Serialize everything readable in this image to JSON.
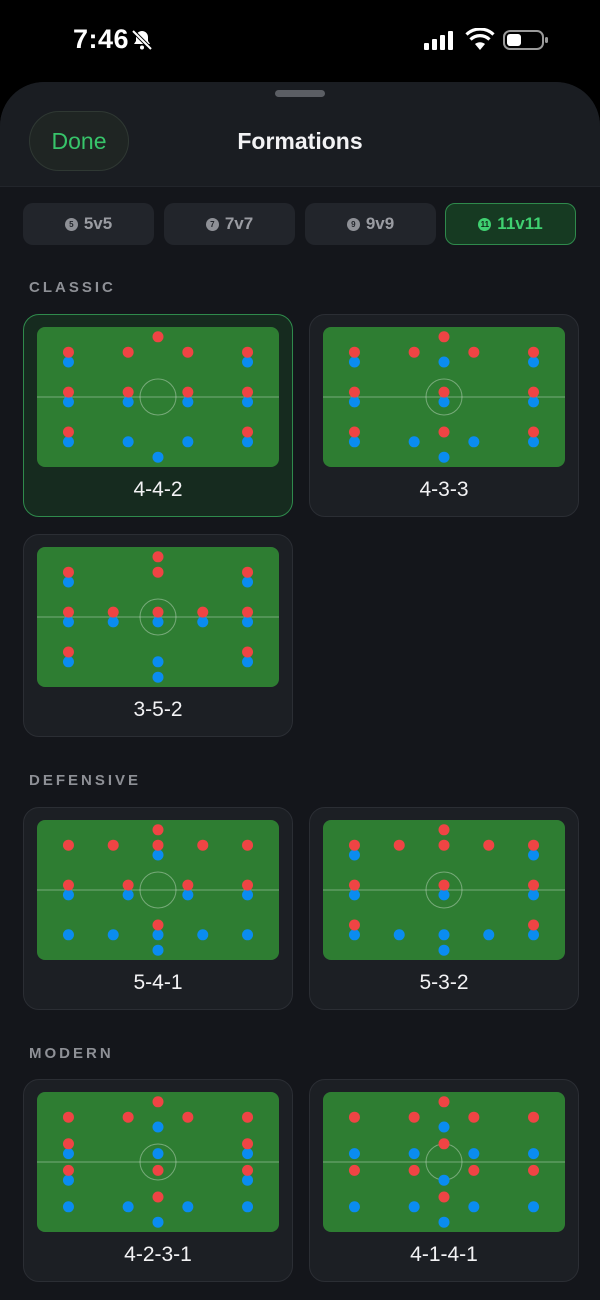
{
  "status_bar": {
    "time": "7:46",
    "icons": [
      "bell-slash-icon",
      "cellular-signal-icon",
      "wifi-icon",
      "battery-icon"
    ]
  },
  "header": {
    "done_label": "Done",
    "title": "Formations"
  },
  "segments": [
    {
      "badge": "5",
      "label": "5v5",
      "active": false
    },
    {
      "badge": "7",
      "label": "7v7",
      "active": false
    },
    {
      "badge": "9",
      "label": "9v9",
      "active": false
    },
    {
      "badge": "11",
      "label": "11v11",
      "active": true
    }
  ],
  "sections": {
    "classic": "CLASSIC",
    "defensive": "DEFENSIVE",
    "modern": "MODERN"
  },
  "formations": [
    {
      "name": "4-4-2",
      "section": "classic",
      "selected": true
    },
    {
      "name": "4-3-3",
      "section": "classic",
      "selected": false
    },
    {
      "name": "3-5-2",
      "section": "classic",
      "selected": false
    },
    {
      "name": "5-4-1",
      "section": "defensive",
      "selected": false
    },
    {
      "name": "5-3-2",
      "section": "defensive",
      "selected": false
    },
    {
      "name": "4-2-3-1",
      "section": "modern",
      "selected": false
    },
    {
      "name": "4-1-4-1",
      "section": "modern",
      "selected": false
    }
  ],
  "colors": {
    "accent_green": "#37c46a",
    "pitch_green": "#2e7d32",
    "team_red": "#ef4444",
    "team_blue": "#0a8cf0",
    "background": "#14161b"
  }
}
